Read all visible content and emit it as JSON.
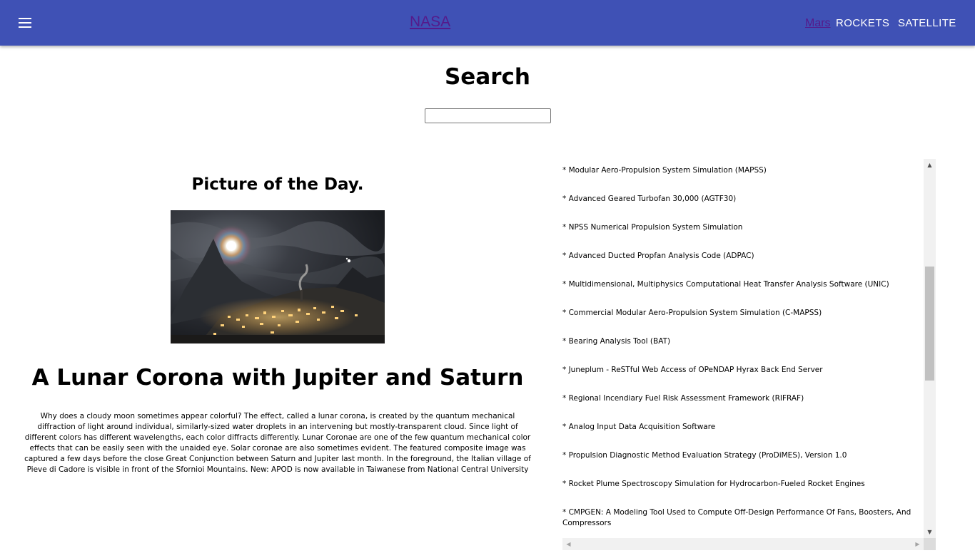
{
  "appbar": {
    "brand": "NASA",
    "nav": {
      "mars": "Mars",
      "rockets": "ROCKETS",
      "satellite": "SATELLITE"
    },
    "color": "#3f51b5"
  },
  "search": {
    "title": "Search",
    "value": "",
    "placeholder": ""
  },
  "potd": {
    "title": "Picture of the Day.",
    "image_alt": "A Lunar Corona with Jupiter and Saturn",
    "article_title": "A Lunar Corona with Jupiter and Saturn",
    "description": "Why does a cloudy moon sometimes appear colorful? The effect, called a lunar corona, is created by the quantum mechanical diffraction of light around individual, similarly-sized water droplets in an intervening but mostly-transparent cloud. Since light of different colors has different wavelengths, each color diffracts differently. Lunar Coronae are one of the few quantum mechanical color effects that can be easily seen with the unaided eye. Solar coronae are also sometimes evident. The featured composite image was captured a few days before the close Great Conjunction between Saturn and Jupiter last month. In the foreground, the Italian village of Pieve di Cadore is visible in front of the Sfornioi Mountains. New: APOD is now available in Taiwanese from National Central University"
  },
  "software_list": [
    "* Modular Aero-Propulsion System Simulation (MAPSS)",
    "* Advanced Geared Turbofan 30,000 (AGTF30)",
    "* NPSS Numerical Propulsion System Simulation",
    "* Advanced Ducted Propfan Analysis Code (ADPAC)",
    "* Multidimensional, Multiphysics Computational Heat Transfer Analysis Software (UNIC)",
    "* Commercial Modular Aero-Propulsion System Simulation (C-MAPSS)",
    "* Bearing Analysis Tool (BAT)",
    "* Juneplum - ReSTful Web Access of OPeNDAP Hyrax Back End Server",
    "* Regional Incendiary Fuel Risk Assessment Framework (RIFRAF)",
    "* Analog Input Data Acquisition Software",
    "* Propulsion Diagnostic Method Evaluation Strategy (ProDiMES), Version 1.0",
    "* Rocket Plume Spectroscopy Simulation for Hydrocarbon-Fueled Rocket Engines",
    "* CMPGEN: A Modeling Tool Used to Compute Off-Design Performance Of Fans, Boosters, And Compressors"
  ]
}
